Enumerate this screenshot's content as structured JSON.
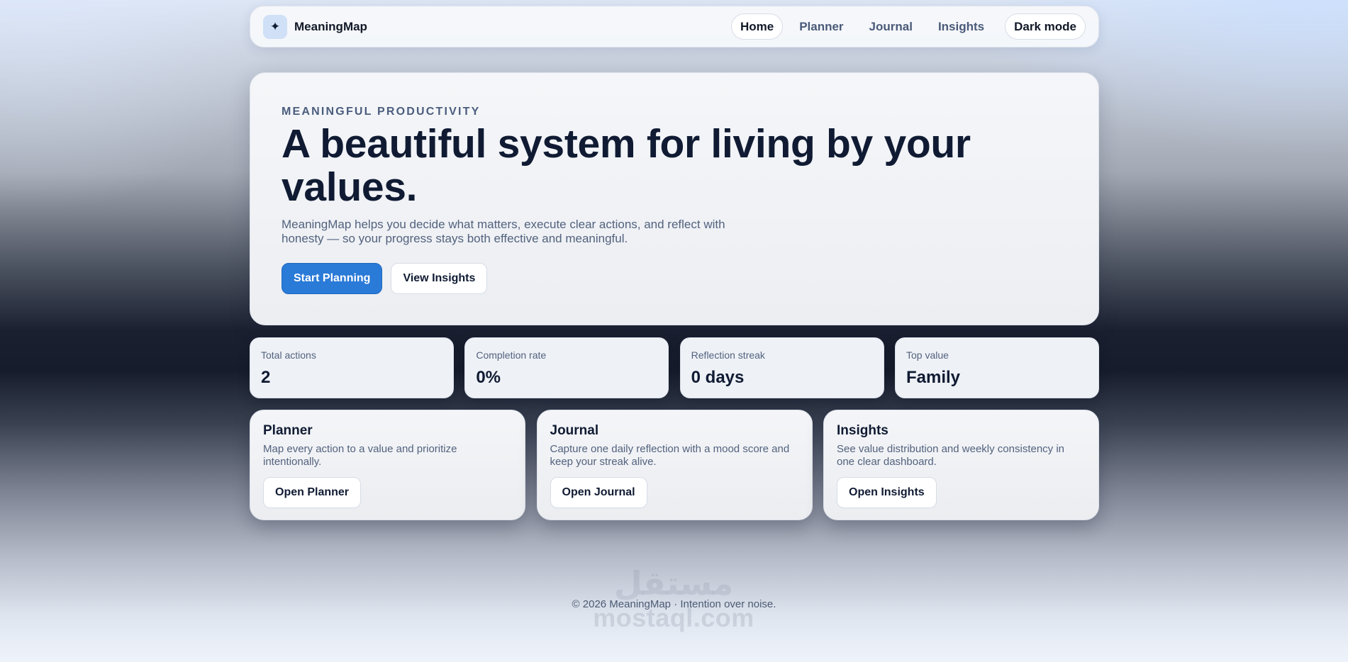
{
  "brand": {
    "icon": "sparkle-icon",
    "glyph": "✦",
    "name": "MeaningMap"
  },
  "nav": {
    "items": [
      {
        "label": "Home",
        "active": true
      },
      {
        "label": "Planner",
        "active": false
      },
      {
        "label": "Journal",
        "active": false
      },
      {
        "label": "Insights",
        "active": false
      }
    ],
    "dark_mode_label": "Dark mode"
  },
  "hero": {
    "eyebrow": "MEANINGFUL PRODUCTIVITY",
    "title": "A beautiful system for living by your values.",
    "description": "MeaningMap helps you decide what matters, execute clear actions, and reflect with honesty — so your progress stays both effective and meaningful.",
    "primary_button": "Start Planning",
    "secondary_button": "View Insights"
  },
  "stats": [
    {
      "label": "Total actions",
      "value": "2"
    },
    {
      "label": "Completion rate",
      "value": "0%"
    },
    {
      "label": "Reflection streak",
      "value": "0 days"
    },
    {
      "label": "Top value",
      "value": "Family"
    }
  ],
  "cards": [
    {
      "title": "Planner",
      "description": "Map every action to a value and prioritize intentionally.",
      "button": "Open Planner"
    },
    {
      "title": "Journal",
      "description": "Capture one daily reflection with a mood score and keep your streak alive.",
      "button": "Open Journal"
    },
    {
      "title": "Insights",
      "description": "See value distribution and weekly consistency in one clear dashboard.",
      "button": "Open Insights"
    }
  ],
  "footer": {
    "text": "© 2026 MeaningMap · Intention over noise."
  },
  "watermark": {
    "arabic": "مستقل",
    "latin": "mostaql.com"
  },
  "colors": {
    "primary": "#2a7ad8",
    "text": "#101b33",
    "muted": "#52627e"
  }
}
